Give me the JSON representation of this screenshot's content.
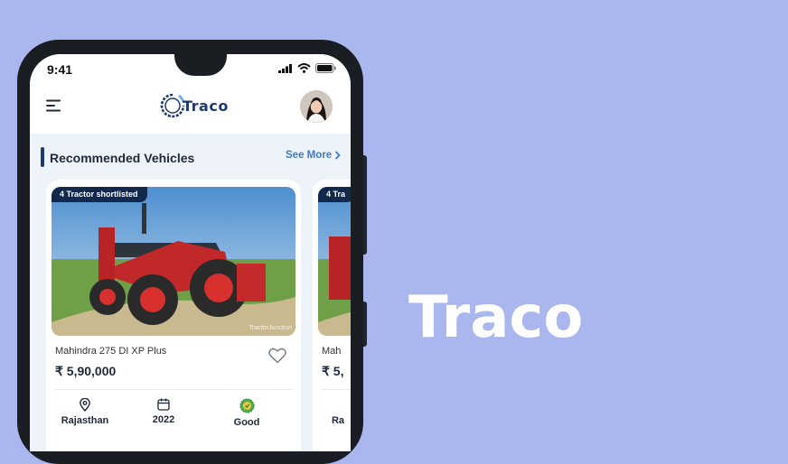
{
  "status_bar": {
    "time": "9:41"
  },
  "app": {
    "logo_text": "Traco",
    "hero_title": "Traco"
  },
  "section": {
    "title": "Recommended Vehicles",
    "see_more": "See More"
  },
  "cards": [
    {
      "badge": "4 Tractor shortlisted",
      "watermark": "TractorJunction",
      "name": "Mahindra 275 DI XP Plus",
      "price": "₹ 5,90,000",
      "location": "Rajasthan",
      "year": "2022",
      "condition": "Good"
    },
    {
      "badge": "4 Tra",
      "name": "Mah",
      "price": "₹ 5,",
      "location": "Ra"
    }
  ],
  "icons": [
    "menu-icon",
    "signal-icon",
    "wifi-icon",
    "battery-icon",
    "chevron-right-icon",
    "heart-icon",
    "location-pin-icon",
    "calendar-icon",
    "condition-badge-icon"
  ],
  "colors": {
    "background": "#a9b7ee",
    "brand_navy": "#1e3a6d",
    "link_blue": "#3a7bd5",
    "badge_bg": "#13284d",
    "condition_green": "#4caf50"
  }
}
